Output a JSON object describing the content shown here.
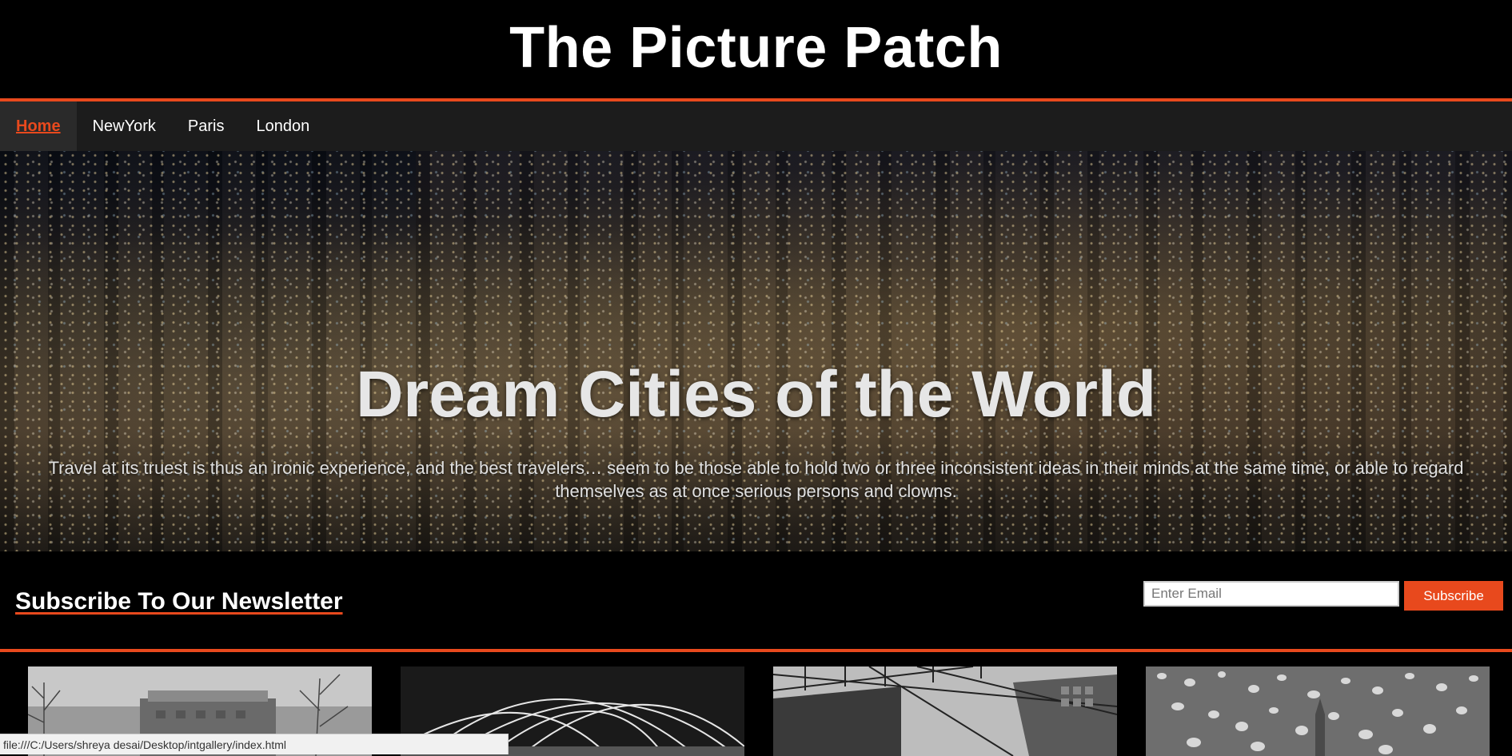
{
  "site": {
    "title": "The Picture Patch"
  },
  "nav": {
    "items": [
      {
        "label": "Home",
        "active": true
      },
      {
        "label": "NewYork",
        "active": false
      },
      {
        "label": "Paris",
        "active": false
      },
      {
        "label": "London",
        "active": false
      }
    ]
  },
  "hero": {
    "title": "Dream Cities of the World",
    "quote": "Travel at its truest is thus an ironic experience, and the best travelers… seem to be those able to hold two or three inconsistent ideas in their minds at the same time, or able to regard themselves as at once serious persons and clowns."
  },
  "newsletter": {
    "heading": "Subscribe To Our Newsletter",
    "email_placeholder": "Enter Email",
    "email_value": "",
    "button_label": "Subscribe"
  },
  "status_bar": {
    "url": "file:///C:/Users/shreya desai/Desktop/intgallery/index.html"
  },
  "colors": {
    "accent": "#e8491d",
    "nav_bg": "#1c1c1c",
    "page_bg": "#000000"
  }
}
